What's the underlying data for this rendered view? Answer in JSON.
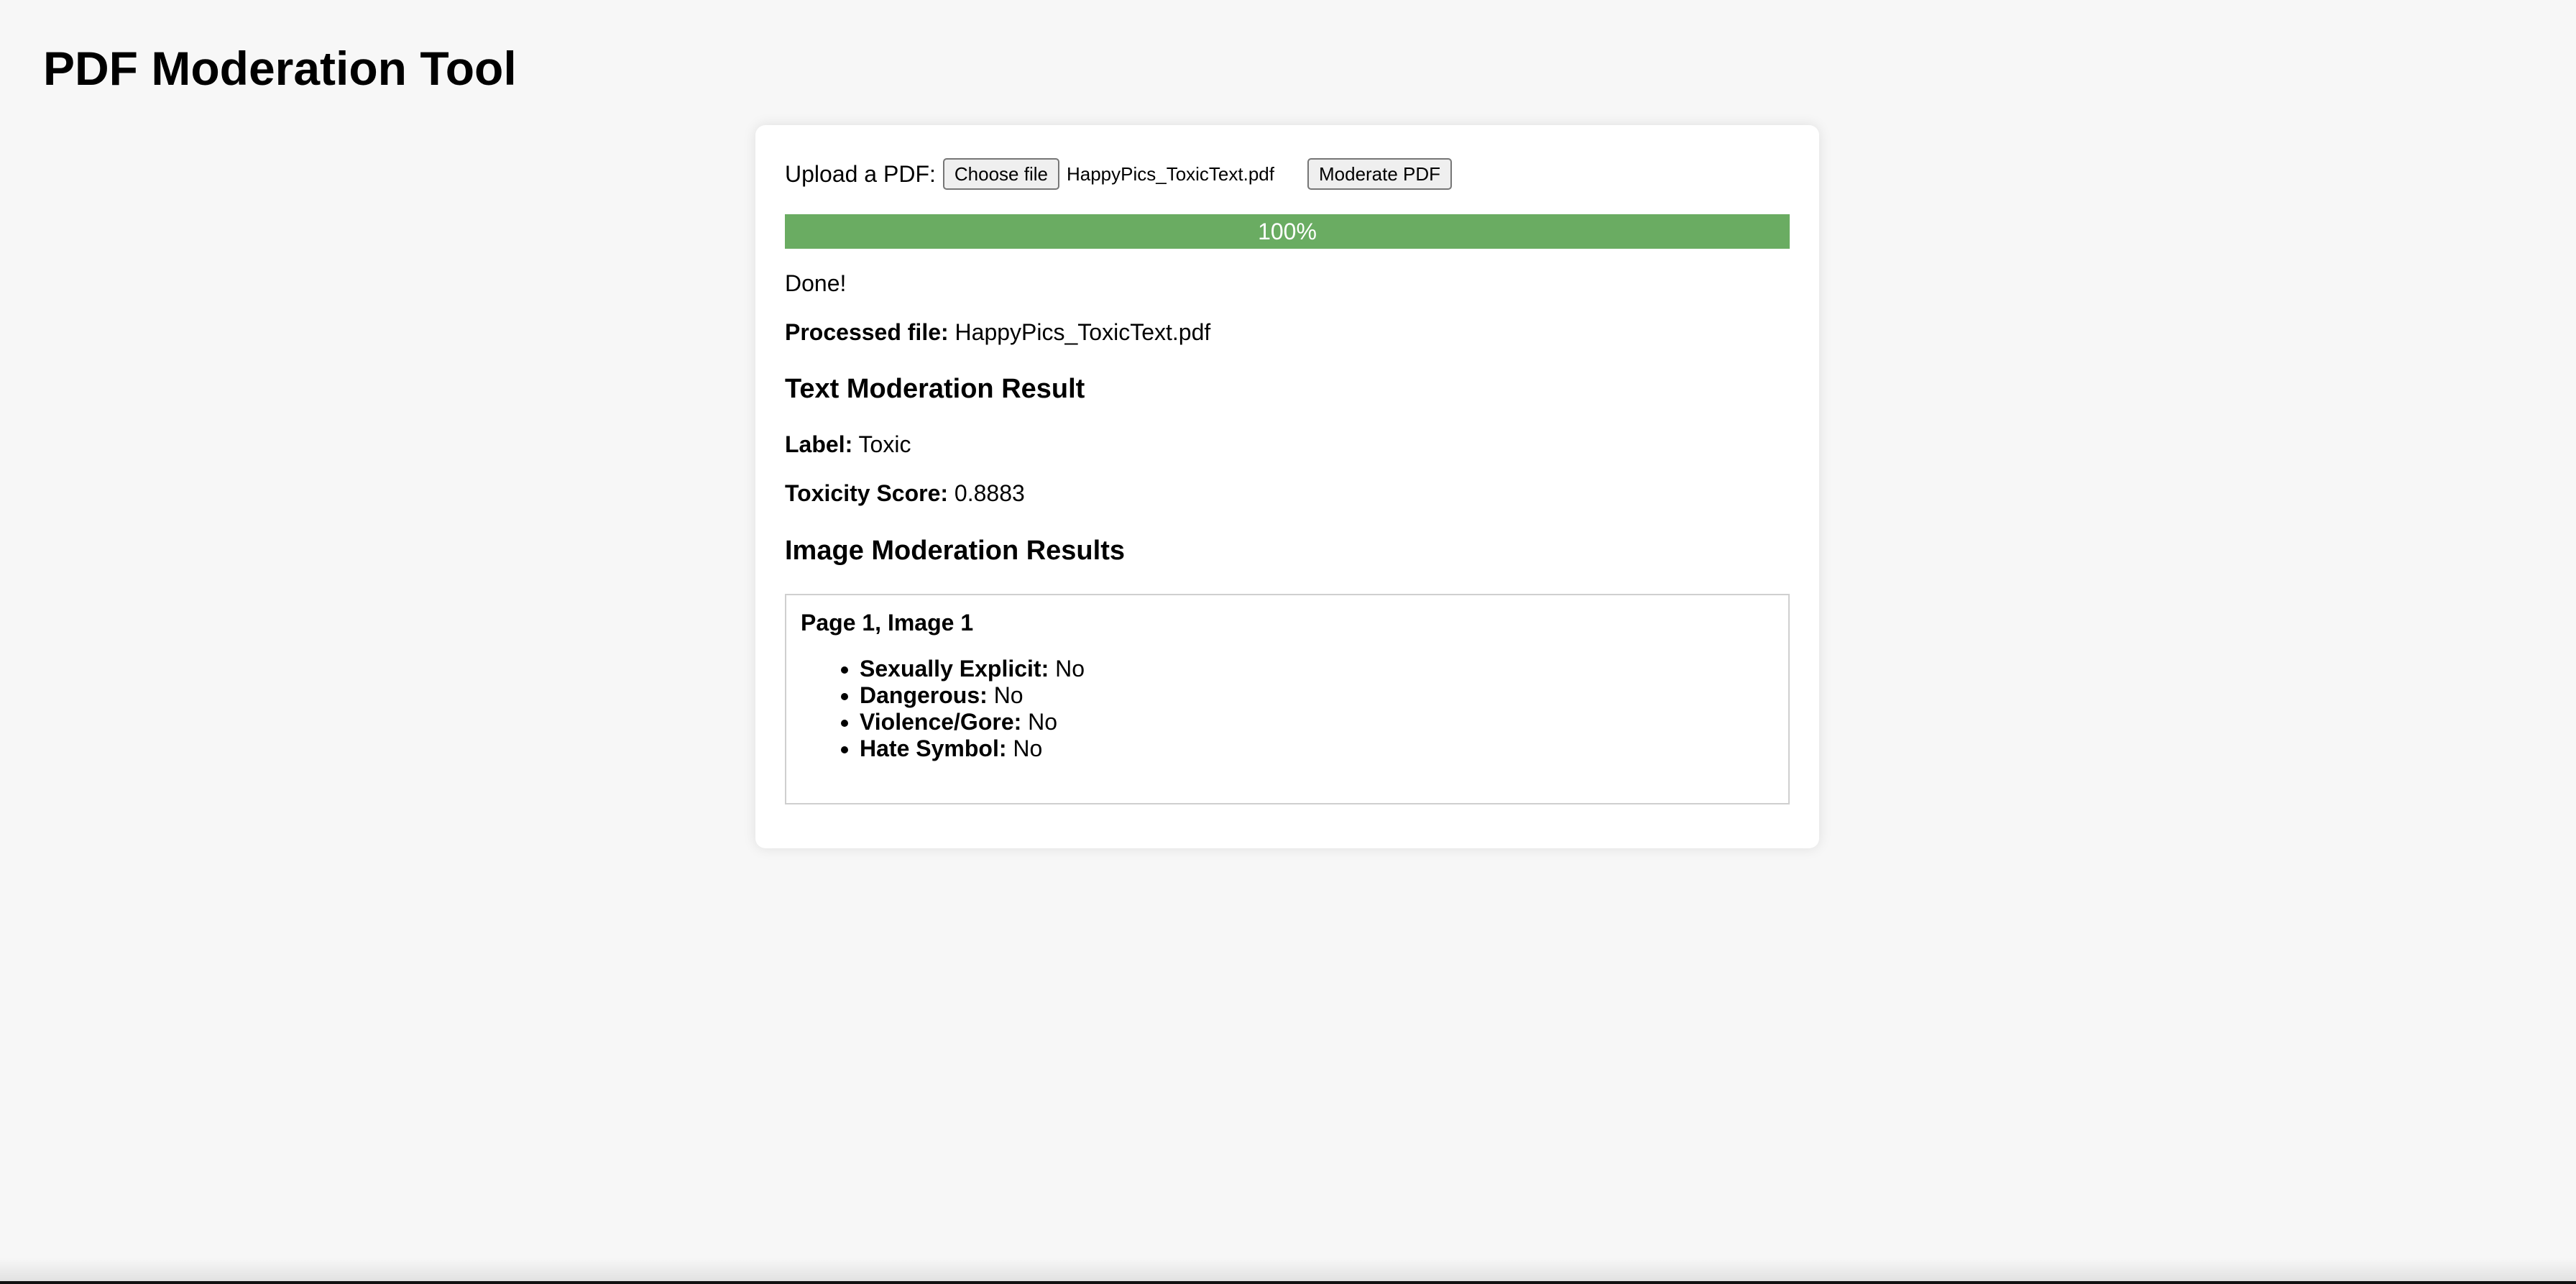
{
  "page": {
    "title": "PDF Moderation Tool"
  },
  "upload": {
    "label": "Upload a PDF:",
    "choose_button": "Choose file",
    "file_name": "HappyPics_ToxicText.pdf",
    "moderate_button": "Moderate PDF"
  },
  "progress": {
    "value": 100,
    "label": "100%",
    "color": "#6aac62"
  },
  "status": "Done!",
  "processed": {
    "label": "Processed file:",
    "value": "HappyPics_ToxicText.pdf"
  },
  "text_moderation": {
    "heading": "Text Moderation Result",
    "label_key": "Label:",
    "label_value": "Toxic",
    "score_key": "Toxicity Score:",
    "score_value": "0.8883"
  },
  "image_moderation": {
    "heading": "Image Moderation Results",
    "items": [
      {
        "title": "Page 1, Image 1",
        "attributes": [
          {
            "key": "Sexually Explicit:",
            "value": "No"
          },
          {
            "key": "Dangerous:",
            "value": "No"
          },
          {
            "key": "Violence/Gore:",
            "value": "No"
          },
          {
            "key": "Hate Symbol:",
            "value": "No"
          }
        ]
      }
    ]
  }
}
